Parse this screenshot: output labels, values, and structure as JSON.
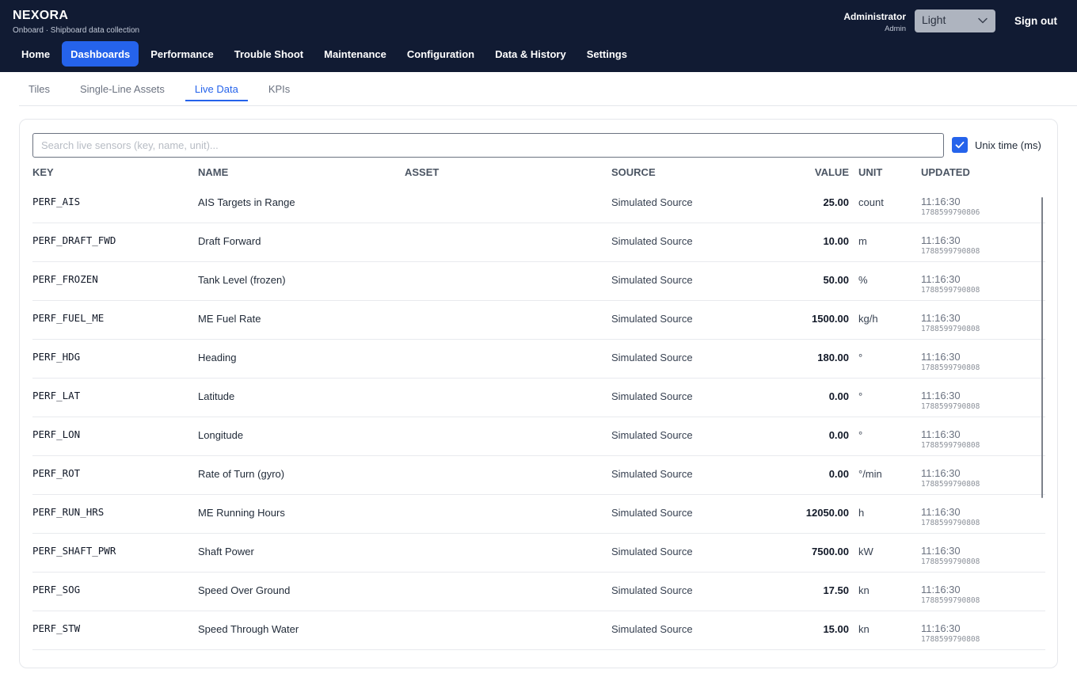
{
  "app": {
    "title": "NEXORA",
    "subtitle": "Onboard · Shipboard data collection"
  },
  "user": {
    "name": "Administrator",
    "role": "Admin",
    "theme": "Light",
    "sign_out": "Sign out"
  },
  "nav": {
    "items": [
      {
        "label": "Home",
        "active": false
      },
      {
        "label": "Dashboards",
        "active": true
      },
      {
        "label": "Performance",
        "active": false
      },
      {
        "label": "Trouble Shoot",
        "active": false
      },
      {
        "label": "Maintenance",
        "active": false
      },
      {
        "label": "Configuration",
        "active": false
      },
      {
        "label": "Data & History",
        "active": false
      },
      {
        "label": "Settings",
        "active": false
      }
    ]
  },
  "tabs": {
    "items": [
      {
        "label": "Tiles",
        "active": false
      },
      {
        "label": "Single-Line Assets",
        "active": false
      },
      {
        "label": "Live Data",
        "active": true
      },
      {
        "label": "KPIs",
        "active": false
      }
    ]
  },
  "search": {
    "placeholder": "Search live sensors (key, name, unit)...",
    "value": ""
  },
  "unix_toggle": {
    "label": "Unix time (ms)",
    "checked": true
  },
  "table": {
    "headers": {
      "key": "KEY",
      "name": "NAME",
      "asset": "ASSET",
      "source": "SOURCE",
      "value": "VALUE",
      "unit": "UNIT",
      "updated": "UPDATED"
    },
    "rows": [
      {
        "key": "PERF_AIS",
        "name": "AIS Targets in Range",
        "asset": "",
        "source": "Simulated Source",
        "value": "25.00",
        "unit": "count",
        "time": "11:16:30",
        "ms": "1788599790806"
      },
      {
        "key": "PERF_DRAFT_FWD",
        "name": "Draft Forward",
        "asset": "",
        "source": "Simulated Source",
        "value": "10.00",
        "unit": "m",
        "time": "11:16:30",
        "ms": "1788599790808"
      },
      {
        "key": "PERF_FROZEN",
        "name": "Tank Level (frozen)",
        "asset": "",
        "source": "Simulated Source",
        "value": "50.00",
        "unit": "%",
        "time": "11:16:30",
        "ms": "1788599790808"
      },
      {
        "key": "PERF_FUEL_ME",
        "name": "ME Fuel Rate",
        "asset": "",
        "source": "Simulated Source",
        "value": "1500.00",
        "unit": "kg/h",
        "time": "11:16:30",
        "ms": "1788599790808"
      },
      {
        "key": "PERF_HDG",
        "name": "Heading",
        "asset": "",
        "source": "Simulated Source",
        "value": "180.00",
        "unit": "°",
        "time": "11:16:30",
        "ms": "1788599790808"
      },
      {
        "key": "PERF_LAT",
        "name": "Latitude",
        "asset": "",
        "source": "Simulated Source",
        "value": "0.00",
        "unit": "°",
        "time": "11:16:30",
        "ms": "1788599790808"
      },
      {
        "key": "PERF_LON",
        "name": "Longitude",
        "asset": "",
        "source": "Simulated Source",
        "value": "0.00",
        "unit": "°",
        "time": "11:16:30",
        "ms": "1788599790808"
      },
      {
        "key": "PERF_ROT",
        "name": "Rate of Turn (gyro)",
        "asset": "",
        "source": "Simulated Source",
        "value": "0.00",
        "unit": "°/min",
        "time": "11:16:30",
        "ms": "1788599790808"
      },
      {
        "key": "PERF_RUN_HRS",
        "name": "ME Running Hours",
        "asset": "",
        "source": "Simulated Source",
        "value": "12050.00",
        "unit": "h",
        "time": "11:16:30",
        "ms": "1788599790808"
      },
      {
        "key": "PERF_SHAFT_PWR",
        "name": "Shaft Power",
        "asset": "",
        "source": "Simulated Source",
        "value": "7500.00",
        "unit": "kW",
        "time": "11:16:30",
        "ms": "1788599790808"
      },
      {
        "key": "PERF_SOG",
        "name": "Speed Over Ground",
        "asset": "",
        "source": "Simulated Source",
        "value": "17.50",
        "unit": "kn",
        "time": "11:16:30",
        "ms": "1788599790808"
      },
      {
        "key": "PERF_STW",
        "name": "Speed Through Water",
        "asset": "",
        "source": "Simulated Source",
        "value": "15.00",
        "unit": "kn",
        "time": "11:16:30",
        "ms": "1788599790808"
      }
    ]
  },
  "colors": {
    "header_bg": "#111b33",
    "accent": "#2563eb",
    "theme_select_bg": "#aeb4bf"
  },
  "icons": {
    "theme_chevron": "chevron-down-icon",
    "checkbox_check": "check-icon"
  }
}
